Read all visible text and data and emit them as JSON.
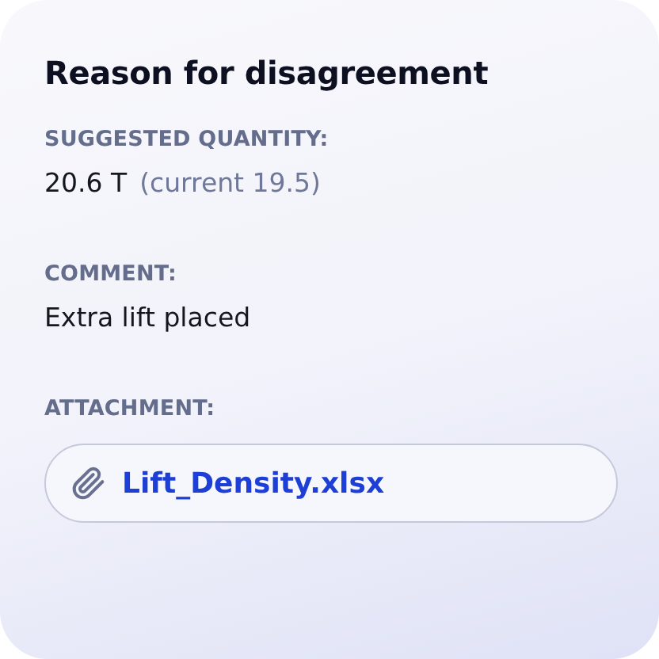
{
  "title": "Reason for disagreement",
  "sections": [
    {
      "kind": "quantity",
      "label": "SUGGESTED QUANTITY:",
      "value": "20.6 T",
      "note": "(current 19.5)"
    },
    {
      "kind": "text",
      "label": "COMMENT:",
      "value": "Extra lift placed"
    },
    {
      "kind": "attachment",
      "label": "ATTACHMENT:",
      "file": "Lift_Density.xlsx"
    }
  ]
}
